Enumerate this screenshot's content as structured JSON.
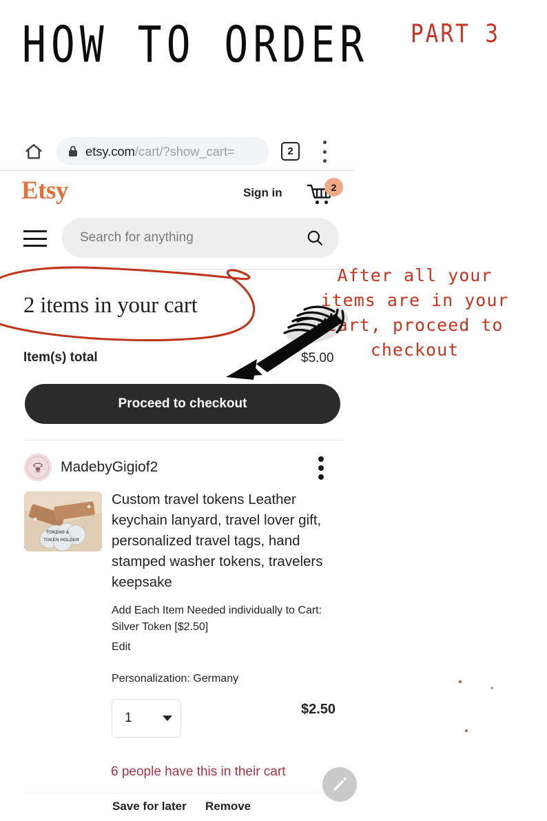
{
  "header": {
    "title": "HOW TO ORDER",
    "part_label": "PART 3"
  },
  "browser": {
    "home_icon": "home-icon",
    "lock_icon": "lock-icon",
    "url_host": "etsy.com",
    "url_path": "/cart/?show_cart=",
    "tab_count": "2",
    "menu_icon": "kebab-menu-icon"
  },
  "site_header": {
    "logo": "Etsy",
    "sign_in": "Sign in",
    "cart_icon": "shopping-cart-icon",
    "cart_badge": "2",
    "menu_icon": "hamburger-menu-icon"
  },
  "search": {
    "placeholder": "Search for anything",
    "icon": "search-icon"
  },
  "cart": {
    "heading": "2 items in your cart",
    "total_label": "Item(s) total",
    "total_value": "$5.00",
    "checkout_button": "Proceed to checkout"
  },
  "item": {
    "shop_name": "MadebyGigiof2",
    "avatar": "shop-avatar",
    "menu_icon": "item-overflow-menu-icon",
    "thumbnail": "product-thumbnail",
    "title": "Custom travel tokens Leather keychain lanyard, travel lover gift, personalized travel tags, hand stamped washer tokens, travelers keepsake",
    "variation": "Add Each Item Needed individually to Cart: Silver Token [$2.50]",
    "edit_link": "Edit",
    "personalization": "Personalization: Germany",
    "quantity": "1",
    "quantity_caret": "chevron-down-icon",
    "price": "$2.50",
    "scarcity": "6 people have this in their cart",
    "save_for_later": "Save for later",
    "remove": "Remove"
  },
  "fab": {
    "icon": "pencil-edit-icon"
  },
  "annotation": {
    "text": "After all your items are in your cart, proceed to checkout",
    "arrow": "arrow-pointing-to-checkout",
    "circle": "circle-around-cart-heading"
  },
  "colors": {
    "annotation_red": "#c5351f",
    "etsy_orange": "#e2703a",
    "badge_orange": "#f1a985",
    "checkout_black": "#2b2b2b",
    "scarcity_red": "#a6344b"
  }
}
